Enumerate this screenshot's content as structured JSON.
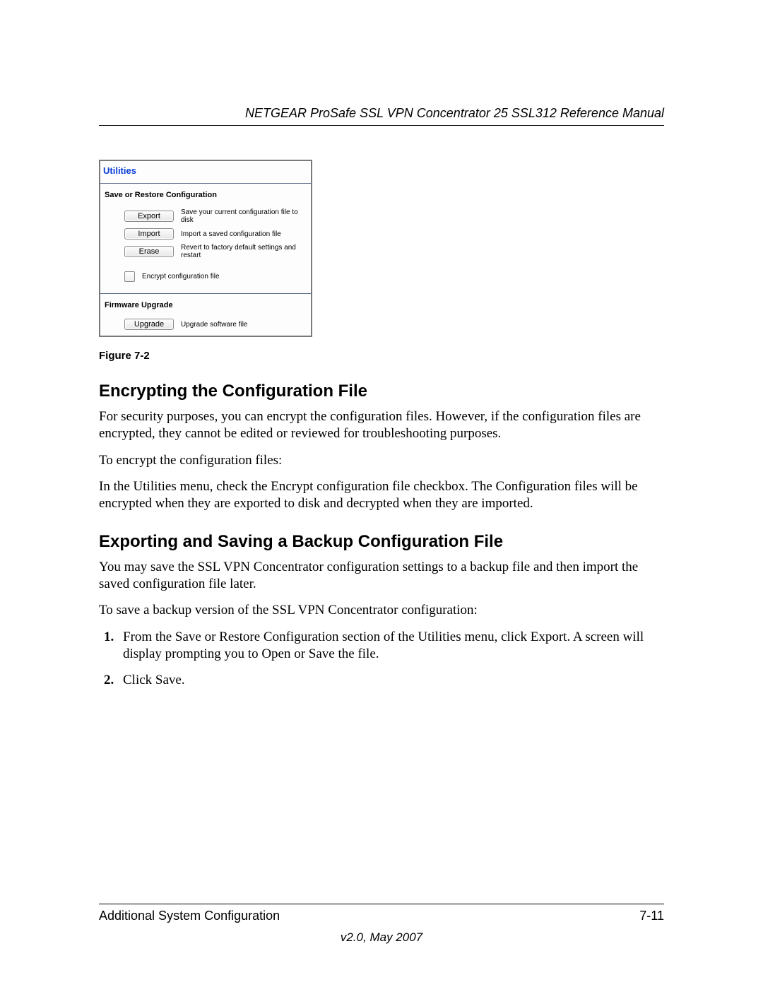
{
  "header": {
    "title": "NETGEAR ProSafe SSL VPN Concentrator 25 SSL312 Reference Manual"
  },
  "screenshot": {
    "panel_title": "Utilities",
    "section1": "Save or Restore Configuration",
    "rows": [
      {
        "btn": "Export",
        "desc": "Save your current configuration file to disk"
      },
      {
        "btn": "Import",
        "desc": "Import a saved configuration file"
      },
      {
        "btn": "Erase",
        "desc": "Revert to factory default settings and restart"
      }
    ],
    "encrypt_label": "Encrypt configuration file",
    "section2": "Firmware Upgrade",
    "upgrade_btn": "Upgrade",
    "upgrade_desc": "Upgrade software file"
  },
  "figure_caption": "Figure 7-2",
  "sec1": {
    "heading": "Encrypting the Configuration File",
    "p1": "For security purposes, you can encrypt the configuration files. However, if the configuration files are encrypted, they cannot be edited or reviewed for troubleshooting purposes.",
    "p2": "To encrypt the configuration files:",
    "p3": "In the Utilities menu, check the Encrypt configuration file checkbox. The Configuration files will be encrypted when they are exported to disk and decrypted when they are imported."
  },
  "sec2": {
    "heading": "Exporting and Saving a Backup Configuration File",
    "p1": "You may save the SSL VPN Concentrator configuration settings to a backup file and then import the saved configuration file later.",
    "p2": "To save a backup version of the SSL VPN Concentrator configuration:",
    "steps": [
      "From the Save or Restore Configuration section of the Utilities menu, click Export. A screen will display prompting you to Open or Save the file.",
      "Click Save."
    ]
  },
  "footer": {
    "left": "Additional System Configuration",
    "right": "7-11",
    "version": "v2.0, May 2007"
  }
}
